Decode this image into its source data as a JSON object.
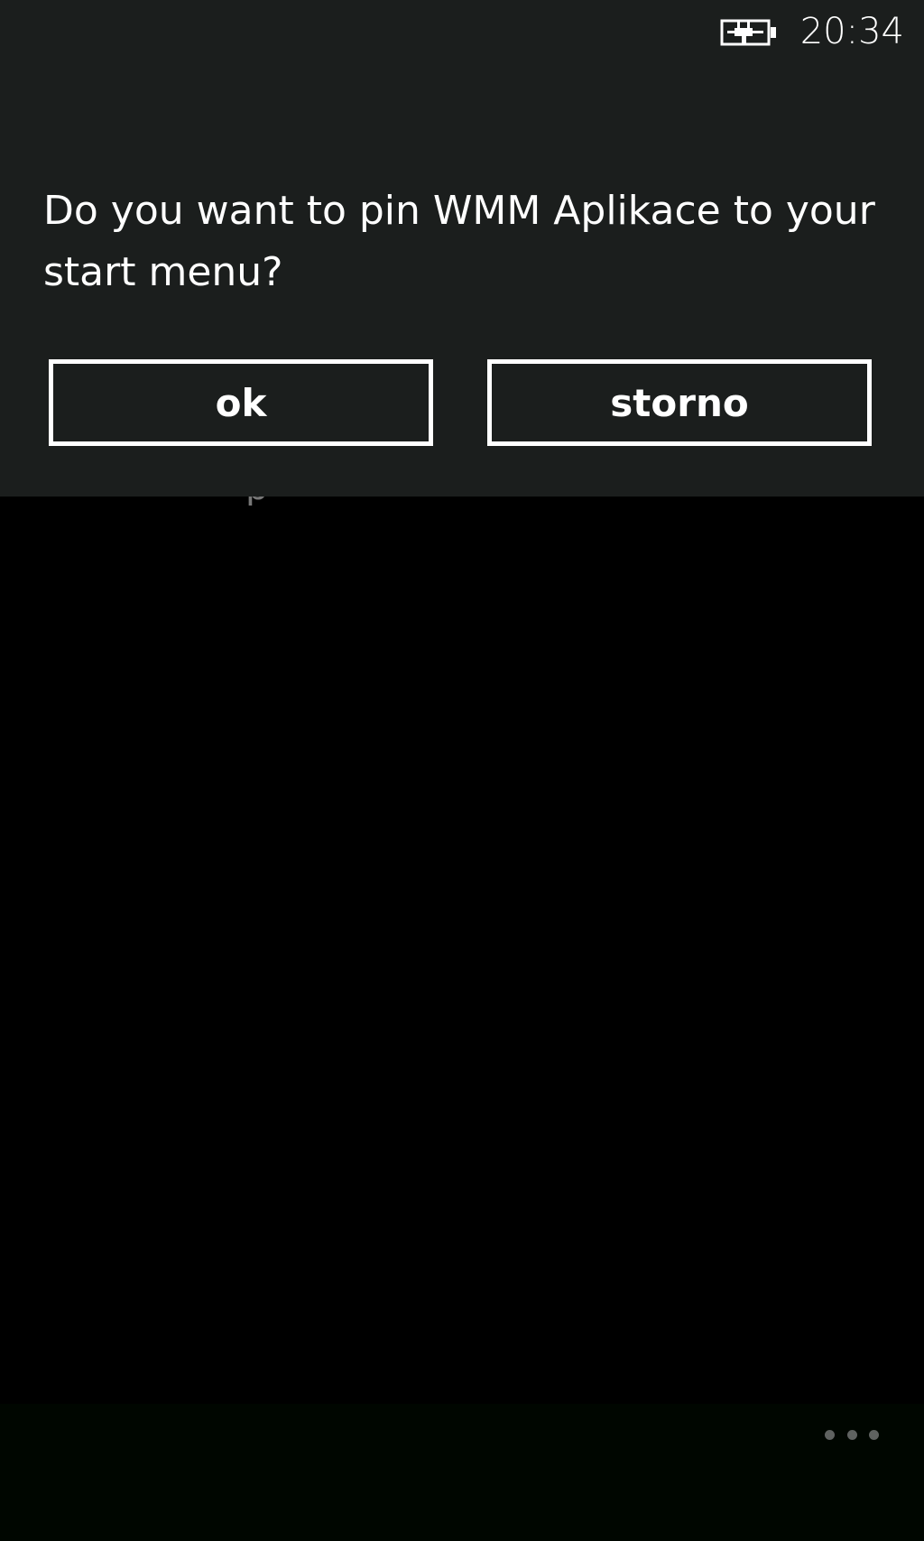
{
  "status_bar": {
    "time": "20:34",
    "battery_icon": "battery-charging-icon"
  },
  "background": {
    "partial_text": "p"
  },
  "dialog": {
    "message": "Do you want to pin WMM Aplikace to your start menu?",
    "ok_label": "ok",
    "cancel_label": "storno"
  },
  "app_bar": {
    "more_icon": "more-ellipsis-icon"
  },
  "colors": {
    "background": "#000000",
    "dialog_background": "#1b1e1d",
    "foreground": "#ffffff",
    "muted": "#5f6260"
  }
}
